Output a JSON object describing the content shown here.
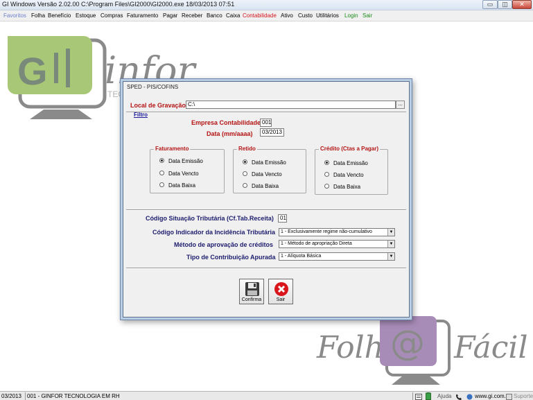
{
  "window": {
    "title": "GI Windows  Versão  2.02.00    C:\\Program Files\\GI2000\\GI2000.exe  18/03/2013 07:51",
    "btn_min": "▭",
    "btn_max": "◫",
    "btn_close": "✕"
  },
  "menu": [
    "Favoritos",
    "Folha",
    "Benefício",
    "Estoque",
    "Compras",
    "Faturamento",
    "Pagar",
    "Receber",
    "Banco",
    "Caixa",
    "Contabilidade",
    "Ativo",
    "Custo",
    "Utilitários",
    "Login",
    "Sair"
  ],
  "logos": {
    "gi_infor": "GI infor TEC",
    "folha_facil": "Folh@ Fácil"
  },
  "dialog": {
    "title": "SPED - PIS/COFINS",
    "local_label": "Local de Gravação",
    "local_value": "C:\\",
    "browse_label": "...",
    "filter_label": "Filtro",
    "empresa_label": "Empresa Contabilidade",
    "empresa_value": "001",
    "data_label": "Data (mm/aaaa)",
    "data_value": "03/2013",
    "groups": [
      {
        "title": "Faturamento",
        "options": [
          "Data Emissão",
          "Data Vencto",
          "Data Baixa"
        ],
        "selected": 0
      },
      {
        "title": "Retido",
        "options": [
          "Data Emissão",
          "Data Vencto",
          "Data Baixa"
        ],
        "selected": 0
      },
      {
        "title": "Crédito (Ctas a Pagar)",
        "options": [
          "Data Emissão",
          "Data Vencto",
          "Data Baixa"
        ],
        "selected": 0
      }
    ],
    "codigo_sit_label": "Código Situação Tributária (Cf.Tab.Receita)",
    "codigo_sit_value": "01",
    "indicador_label": "Código Indicador da Incidência Tributária",
    "indicador_value": "1 - Exclusivamente regime não-cumulativo",
    "metodo_label": "Método de aprovação de créditos",
    "metodo_value": "1 - Método de apropriação Direta",
    "tipo_label": "Tipo de Contribuição Apurada",
    "tipo_value": "1 - Alíquota Básica",
    "confirma_label": "Confirma",
    "sair_label": "Sair"
  },
  "status": {
    "date": "03/2013",
    "company": "001 - GINFOR TECNOLOGIA EM RH",
    "ajuda": "Ajuda",
    "site": "www.gi.com.br",
    "suporte": "Suporte"
  }
}
